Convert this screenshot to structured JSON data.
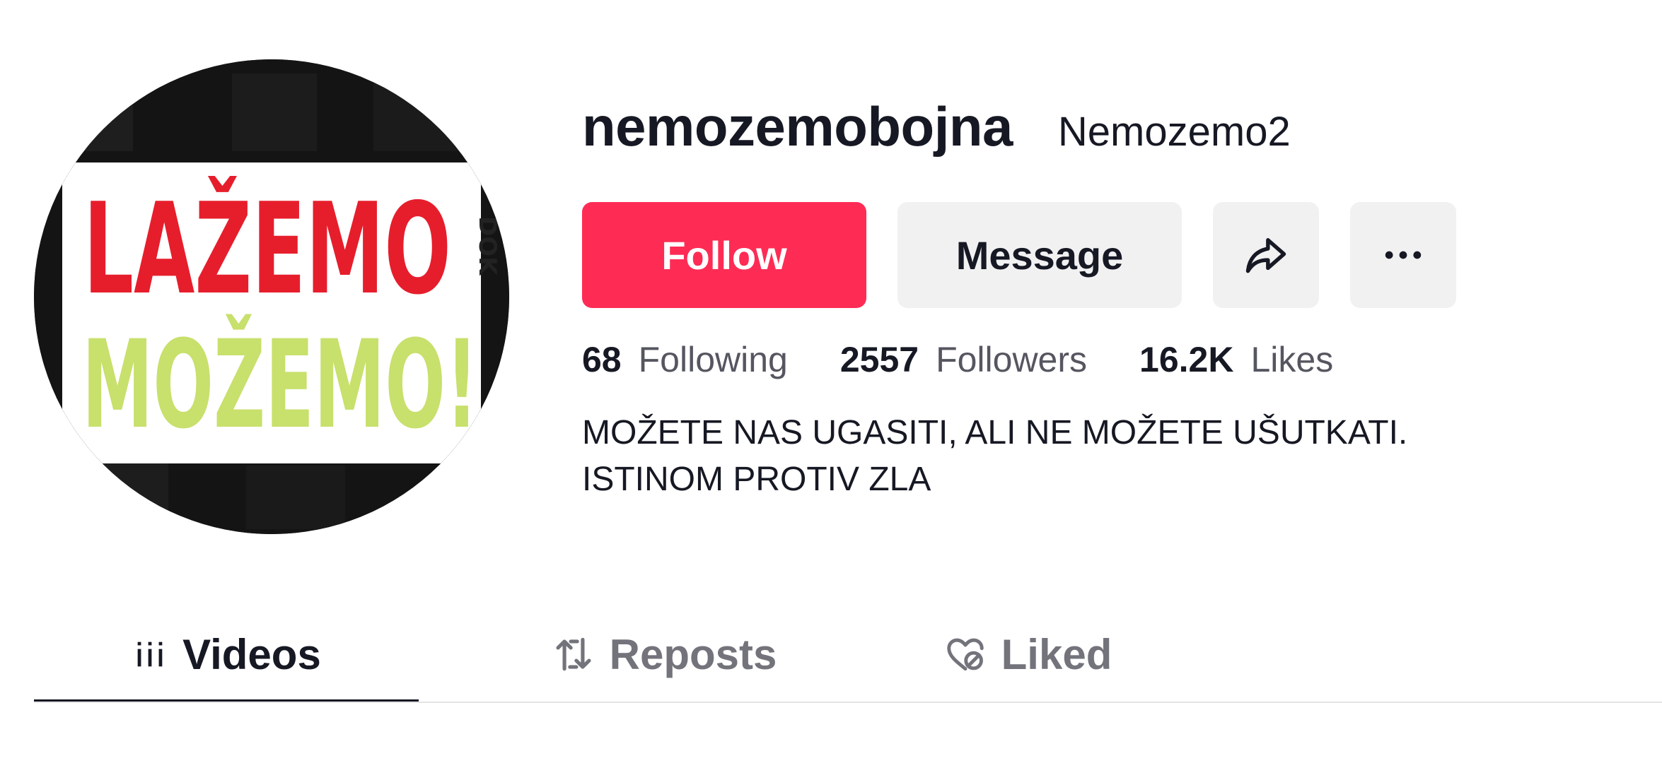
{
  "profile": {
    "username": "nemozemobojna",
    "nickname": "Nemozemo2",
    "avatar_logo_text": "LAŽEMO DOK MOŽEMO!"
  },
  "actions": {
    "follow_label": "Follow",
    "message_label": "Message",
    "share_icon": "share-icon",
    "more_icon": "more-icon"
  },
  "stats": {
    "following": {
      "count": "68",
      "label": "Following"
    },
    "followers": {
      "count": "2557",
      "label": "Followers"
    },
    "likes": {
      "count": "16.2K",
      "label": "Likes"
    }
  },
  "bio": {
    "line1": "MOŽETE NAS UGASITI, ALI NE MOŽETE UŠUTKATI.",
    "line2": "ISTINOM PROTIV ZLA"
  },
  "tabs": [
    {
      "label": "Videos",
      "icon": "grid-icon",
      "active": true
    },
    {
      "label": "Reposts",
      "icon": "repost-icon",
      "active": false
    },
    {
      "label": "Liked",
      "icon": "heart-hidden-icon",
      "active": false
    }
  ],
  "colors": {
    "accent": "#fe2c55",
    "text": "#161823",
    "muted": "#73747b",
    "button_gray": "#f1f1f2",
    "logo_red": "#e61e2c",
    "logo_green": "#c8e06c"
  }
}
